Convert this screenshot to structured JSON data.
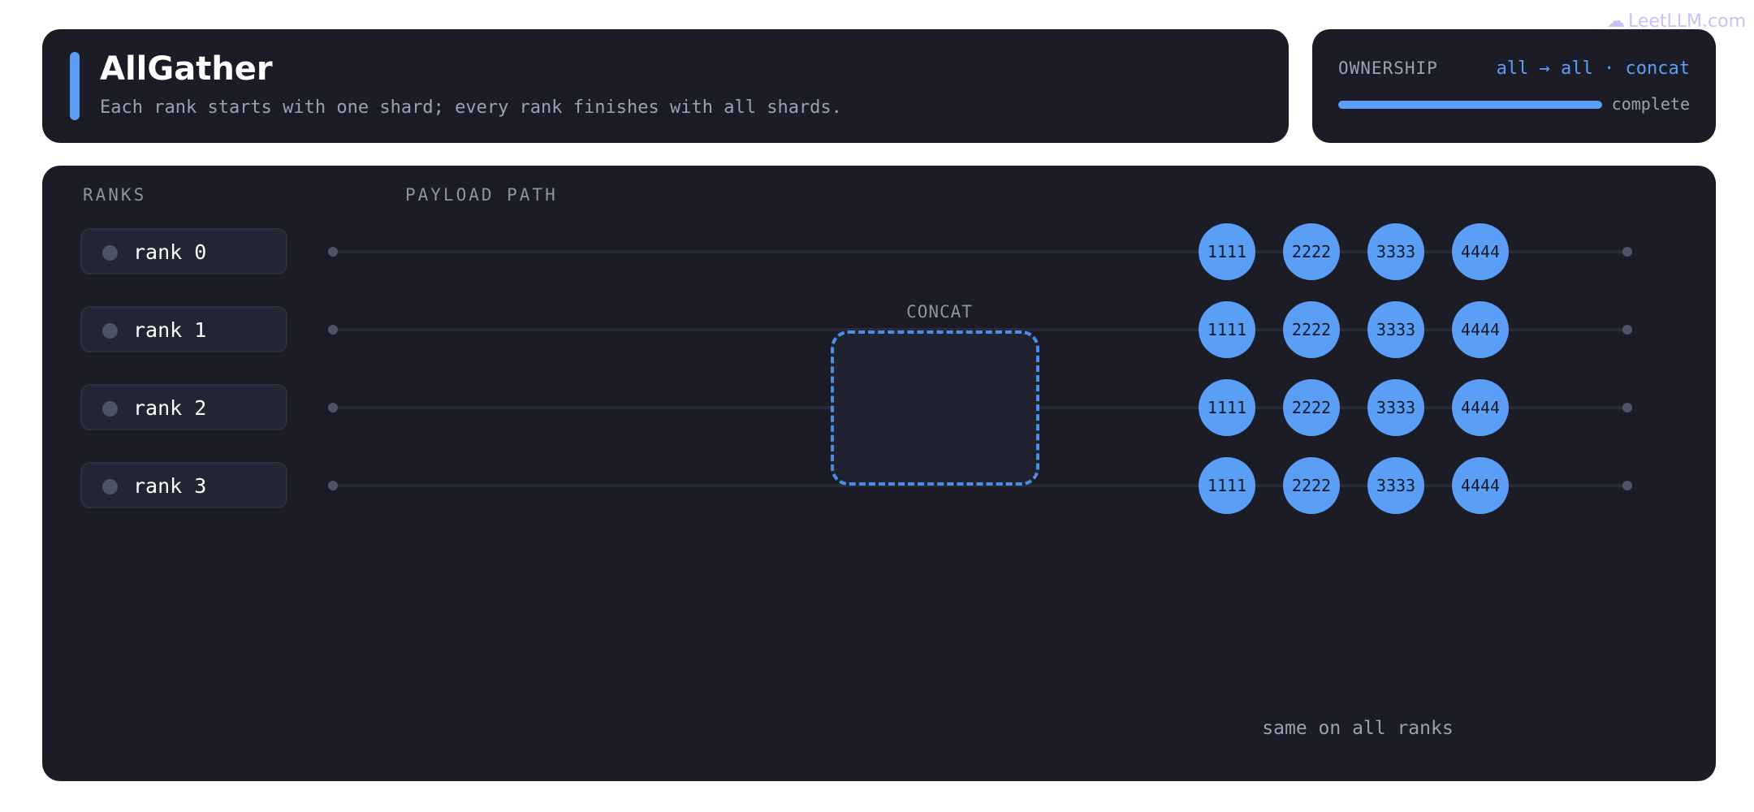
{
  "header": {
    "title": "AllGather",
    "subtitle": "Each rank starts with one shard; every rank finishes with all shards."
  },
  "ownership": {
    "label": "OWNERSHIP",
    "flow": "all → all · concat",
    "status": "complete",
    "progress": 1.0
  },
  "diagram": {
    "ranks_label": "RANKS",
    "path_label": "PAYLOAD PATH",
    "ranks": [
      {
        "label": "rank 0",
        "shards": [
          "1111",
          "2222",
          "3333",
          "4444"
        ]
      },
      {
        "label": "rank 1",
        "shards": [
          "1111",
          "2222",
          "3333",
          "4444"
        ]
      },
      {
        "label": "rank 2",
        "shards": [
          "1111",
          "2222",
          "3333",
          "4444"
        ]
      },
      {
        "label": "rank 3",
        "shards": [
          "1111",
          "2222",
          "3333",
          "4444"
        ]
      }
    ],
    "concat_label": "CONCAT",
    "footer_note": "same on all ranks"
  },
  "watermark": {
    "text": "LeetLLM.com",
    "icon": "brain-icon"
  },
  "colors": {
    "accent": "#5b9ef5",
    "card_bg": "#1c1c27",
    "shard_fill": "#5b9ef5"
  }
}
